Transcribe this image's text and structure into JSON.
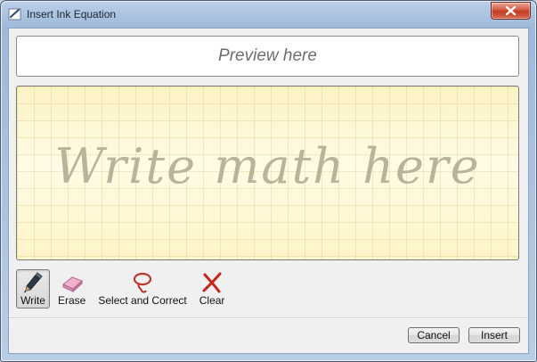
{
  "window": {
    "title": "Insert Ink Equation",
    "title_icon": "ink-pen-icon",
    "close_icon": "close-icon"
  },
  "preview": {
    "placeholder": "Preview here"
  },
  "ink_area": {
    "placeholder": "Write math here"
  },
  "tools": [
    {
      "label": "Write",
      "icon": "pen-icon",
      "active": true
    },
    {
      "label": "Erase",
      "icon": "eraser-icon",
      "active": false
    },
    {
      "label": "Select and Correct",
      "icon": "lasso-icon",
      "active": false
    },
    {
      "label": "Clear",
      "icon": "clear-x-icon",
      "active": false
    }
  ],
  "buttons": {
    "cancel_label": "Cancel",
    "insert_label": "Insert"
  },
  "colors": {
    "ink_background": "#fdf7cf",
    "clear_red": "#c8261d",
    "lasso_red": "#b8352b"
  }
}
